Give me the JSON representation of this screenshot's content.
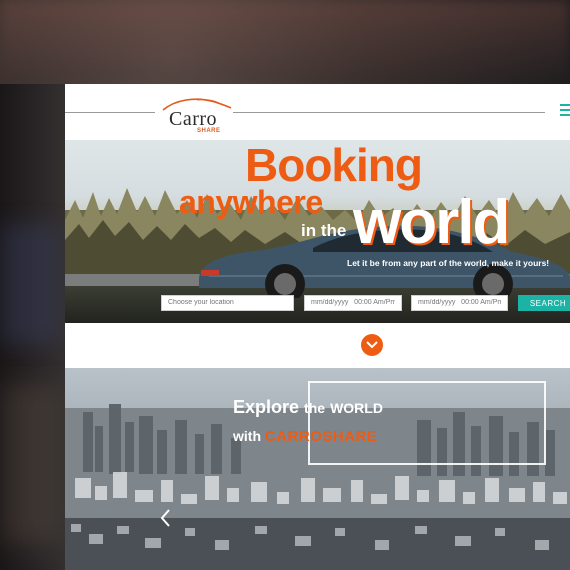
{
  "header": {
    "logo_text": "Carro",
    "logo_sub": "SHARE"
  },
  "hero": {
    "line1": "Booking",
    "line2": "anywhere",
    "line3": "in the",
    "line4": "world",
    "tagline": "Let it be from any part of the world, make it yours!"
  },
  "search": {
    "location_placeholder": "Choose your location",
    "pickup_placeholder": "mm/dd/yyyy   00:00 Am/Pm",
    "dropoff_placeholder": "mm/dd/yyyy   00:00 Am/Pm",
    "button_label": "SEARCH"
  },
  "explore": {
    "word1": "Explore",
    "word2": "the",
    "word3": "WORLD",
    "with": "with",
    "brand": "CARROSHARE"
  },
  "colors": {
    "accent": "#ee5b12",
    "teal": "#1bb3a5"
  },
  "icons": [
    "menu-icon",
    "chevron-down-icon",
    "chevron-left-icon"
  ]
}
